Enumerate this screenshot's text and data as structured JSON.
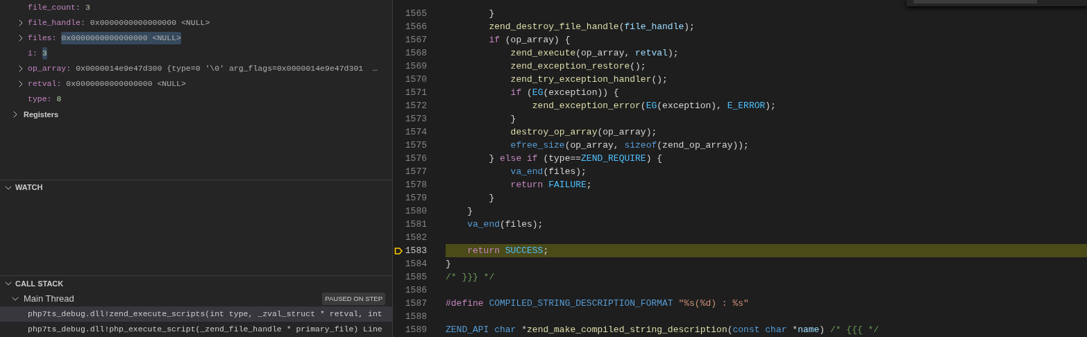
{
  "variables": [
    {
      "name": "file_count:",
      "value": "3",
      "kind": "number",
      "expandable": false,
      "highlighted": false
    },
    {
      "name": "file_handle:",
      "value": "0x0000000000000000 <NULL>",
      "kind": "text",
      "expandable": true,
      "highlighted": false
    },
    {
      "name": "files:",
      "value": "0x0000000000000000 <NULL>",
      "kind": "text",
      "expandable": true,
      "highlighted": true
    },
    {
      "name": "i:",
      "value": "3",
      "kind": "number",
      "expandable": false,
      "highlighted": true
    },
    {
      "name": "op_array:",
      "value": "0x0000014e9e47d300 {type=0 '\\0' arg_flags=0x0000014e9e47d301  …",
      "kind": "text",
      "expandable": true,
      "highlighted": false
    },
    {
      "name": "retval:",
      "value": "0x0000000000000000 <NULL>",
      "kind": "text",
      "expandable": true,
      "highlighted": false
    },
    {
      "name": "type:",
      "value": "8",
      "kind": "number",
      "expandable": false,
      "highlighted": false
    }
  ],
  "registers": {
    "label": "Registers",
    "expanded": false
  },
  "watch": {
    "title": "WATCH",
    "expanded": true
  },
  "call_stack": {
    "title": "CALL STACK",
    "expanded": true,
    "threads": [
      {
        "label": "Main Thread",
        "expanded": true,
        "badge": "PAUSED ON STEP",
        "frames": [
          {
            "label": "php7ts_debug.dll!zend_execute_scripts(int type, _zval_struct * retval, int",
            "selected": true
          },
          {
            "label": "php7ts_debug.dll!php_execute_script(_zend_file_handle * primary_file) Line",
            "selected": false
          }
        ]
      }
    ]
  },
  "editor": {
    "lines": [
      {
        "number": "1565",
        "current": false,
        "tokens": [
          {
            "kind": "plain",
            "text": "        }"
          }
        ]
      },
      {
        "number": "1566",
        "current": false,
        "tokens": [
          {
            "kind": "function",
            "text": "        zend_destroy_file_handle"
          },
          {
            "kind": "plain",
            "text": "("
          },
          {
            "kind": "variable",
            "text": "file_handle"
          },
          {
            "kind": "plain",
            "text": ");"
          }
        ]
      },
      {
        "number": "1567",
        "current": false,
        "tokens": [
          {
            "kind": "control",
            "text": "        if"
          },
          {
            "kind": "plain",
            "text": " (op_array) {"
          }
        ]
      },
      {
        "number": "1568",
        "current": false,
        "tokens": [
          {
            "kind": "function",
            "text": "            zend_execute"
          },
          {
            "kind": "plain",
            "text": "(op_array, "
          },
          {
            "kind": "variable",
            "text": "retval"
          },
          {
            "kind": "plain",
            "text": ");"
          }
        ]
      },
      {
        "number": "1569",
        "current": false,
        "tokens": [
          {
            "kind": "function",
            "text": "            zend_exception_restore"
          },
          {
            "kind": "plain",
            "text": "();"
          }
        ]
      },
      {
        "number": "1570",
        "current": false,
        "tokens": [
          {
            "kind": "function",
            "text": "            zend_try_exception_handler"
          },
          {
            "kind": "plain",
            "text": "();"
          }
        ]
      },
      {
        "number": "1571",
        "current": false,
        "tokens": [
          {
            "kind": "control",
            "text": "            if"
          },
          {
            "kind": "plain",
            "text": " ("
          },
          {
            "kind": "macro",
            "text": "EG"
          },
          {
            "kind": "plain",
            "text": "(exception)) {"
          }
        ]
      },
      {
        "number": "1572",
        "current": false,
        "tokens": [
          {
            "kind": "function",
            "text": "                zend_exception_error"
          },
          {
            "kind": "plain",
            "text": "("
          },
          {
            "kind": "macro",
            "text": "EG"
          },
          {
            "kind": "plain",
            "text": "(exception), "
          },
          {
            "kind": "macro",
            "text": "E_ERROR"
          },
          {
            "kind": "plain",
            "text": ");"
          }
        ]
      },
      {
        "number": "1573",
        "current": false,
        "tokens": [
          {
            "kind": "plain",
            "text": "            }"
          }
        ]
      },
      {
        "number": "1574",
        "current": false,
        "tokens": [
          {
            "kind": "function",
            "text": "            destroy_op_array"
          },
          {
            "kind": "plain",
            "text": "(op_array);"
          }
        ]
      },
      {
        "number": "1575",
        "current": false,
        "tokens": [
          {
            "kind": "keyword",
            "text": "            efree_size"
          },
          {
            "kind": "plain",
            "text": "(op_array, "
          },
          {
            "kind": "keyword",
            "text": "sizeof"
          },
          {
            "kind": "plain",
            "text": "(zend_op_array));"
          }
        ]
      },
      {
        "number": "1576",
        "current": false,
        "tokens": [
          {
            "kind": "plain",
            "text": "        } "
          },
          {
            "kind": "control",
            "text": "else if"
          },
          {
            "kind": "plain",
            "text": " (type=="
          },
          {
            "kind": "macro",
            "text": "ZEND_REQUIRE"
          },
          {
            "kind": "plain",
            "text": ") {"
          }
        ]
      },
      {
        "number": "1577",
        "current": false,
        "tokens": [
          {
            "kind": "keyword",
            "text": "            va_end"
          },
          {
            "kind": "plain",
            "text": "(files);"
          }
        ]
      },
      {
        "number": "1578",
        "current": false,
        "tokens": [
          {
            "kind": "control",
            "text": "            return"
          },
          {
            "kind": "macro",
            "text": " FAILURE"
          },
          {
            "kind": "plain",
            "text": ";"
          }
        ]
      },
      {
        "number": "1579",
        "current": false,
        "tokens": [
          {
            "kind": "plain",
            "text": "        }"
          }
        ]
      },
      {
        "number": "1580",
        "current": false,
        "tokens": [
          {
            "kind": "plain",
            "text": "    }"
          }
        ]
      },
      {
        "number": "1581",
        "current": false,
        "tokens": [
          {
            "kind": "keyword",
            "text": "    va_end"
          },
          {
            "kind": "plain",
            "text": "(files);"
          }
        ]
      },
      {
        "number": "1582",
        "current": false
      },
      {
        "number": "1583",
        "current": true,
        "tokens": [
          {
            "kind": "control",
            "text": "    return"
          },
          {
            "kind": "macro",
            "text": " SUCCESS"
          },
          {
            "kind": "plain",
            "text": ";"
          }
        ]
      },
      {
        "number": "1584",
        "current": false,
        "tokens": [
          {
            "kind": "plain",
            "text": "}"
          }
        ]
      },
      {
        "number": "1585",
        "current": false,
        "tokens": [
          {
            "kind": "comment",
            "text": "/* }}} */"
          }
        ]
      },
      {
        "number": "1586",
        "current": false
      },
      {
        "number": "1587",
        "current": false,
        "tokens": [
          {
            "kind": "control",
            "text": "#define"
          },
          {
            "kind": "keyword",
            "text": " COMPILED_STRING_DESCRIPTION_FORMAT"
          },
          {
            "kind": "string",
            "text": " \"%s(%d) : %s\""
          }
        ]
      },
      {
        "number": "1588",
        "current": false
      },
      {
        "number": "1589",
        "current": false,
        "tokens": [
          {
            "kind": "keyword",
            "text": "ZEND_API char"
          },
          {
            "kind": "plain",
            "text": " *"
          },
          {
            "kind": "function",
            "text": "zend_make_compiled_string_description"
          },
          {
            "kind": "plain",
            "text": "("
          },
          {
            "kind": "keyword",
            "text": "const char"
          },
          {
            "kind": "plain",
            "text": " *"
          },
          {
            "kind": "variable",
            "text": "name"
          },
          {
            "kind": "plain",
            "text": ") "
          },
          {
            "kind": "comment",
            "text": "/* {{{ */"
          }
        ]
      }
    ]
  }
}
